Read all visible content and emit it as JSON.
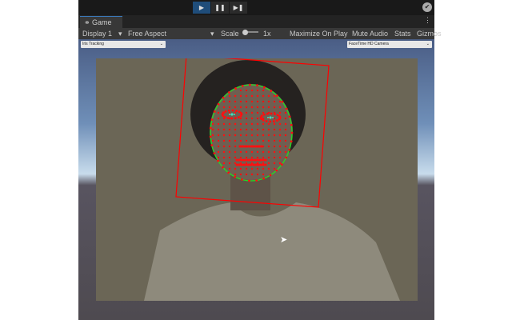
{
  "toolbar": {
    "play": "▶",
    "pause": "❚❚",
    "step": "▶❚"
  },
  "tab": {
    "label": "Game",
    "menu": "⋮"
  },
  "game_toolbar": {
    "display": "Display 1",
    "aspect": "Free Aspect",
    "scale_label": "Scale",
    "scale_value": "1x",
    "maximize": "Maximize On Play",
    "mute": "Mute Audio",
    "stats": "Stats",
    "gizmos": "Gizmos"
  },
  "dropdowns": {
    "mode": "Iris Tracking",
    "camera": "FaceTime HD Camera"
  },
  "colors": {
    "landmark": "#ff1010",
    "contour": "#22dd22",
    "iris": "#40e0c0",
    "box": "#ff0000"
  }
}
